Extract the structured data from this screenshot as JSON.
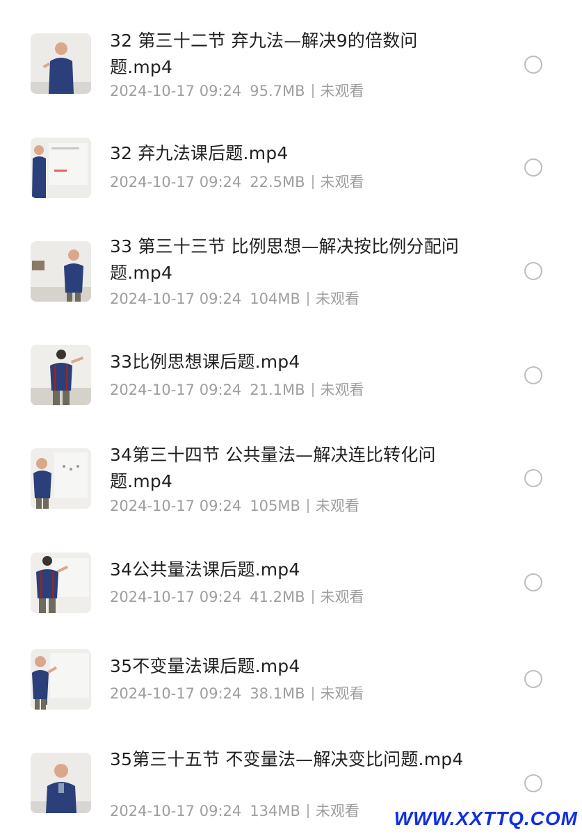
{
  "files": [
    {
      "title": "32 第三十二节 弃九法—解决9的倍数问题.mp4",
      "date": "2024-10-17 09:24",
      "size": "95.7MB",
      "status": "未观看"
    },
    {
      "title": "32 弃九法课后题.mp4",
      "date": "2024-10-17 09:24",
      "size": "22.5MB",
      "status": "未观看"
    },
    {
      "title": "33 第三十三节 比例思想—解决按比例分配问题.mp4",
      "date": "2024-10-17 09:24",
      "size": "104MB",
      "status": "未观看"
    },
    {
      "title": "33比例思想课后题.mp4",
      "date": "2024-10-17 09:24",
      "size": "21.1MB",
      "status": "未观看"
    },
    {
      "title": "34第三十四节 公共量法—解决连比转化问题.mp4",
      "date": "2024-10-17 09:24",
      "size": "105MB",
      "status": "未观看"
    },
    {
      "title": "34公共量法课后题.mp4",
      "date": "2024-10-17 09:24",
      "size": "41.2MB",
      "status": "未观看"
    },
    {
      "title": "35不变量法课后题.mp4",
      "date": "2024-10-17 09:24",
      "size": "38.1MB",
      "status": "未观看"
    },
    {
      "title": "35第三十五节 不变量法—解决变比问题.mp4",
      "date": "2024-10-17 09:24",
      "size": "134MB",
      "status": "未观看"
    }
  ],
  "icons": {
    "thumbnail": "video-thumbnail-icon",
    "select": "radio-circle-icon"
  },
  "colors": {
    "title": "#1f1f1f",
    "meta": "#9e9e9e",
    "watermark": "#1030e0"
  },
  "watermark": "WWW.XXTTQ.COM"
}
